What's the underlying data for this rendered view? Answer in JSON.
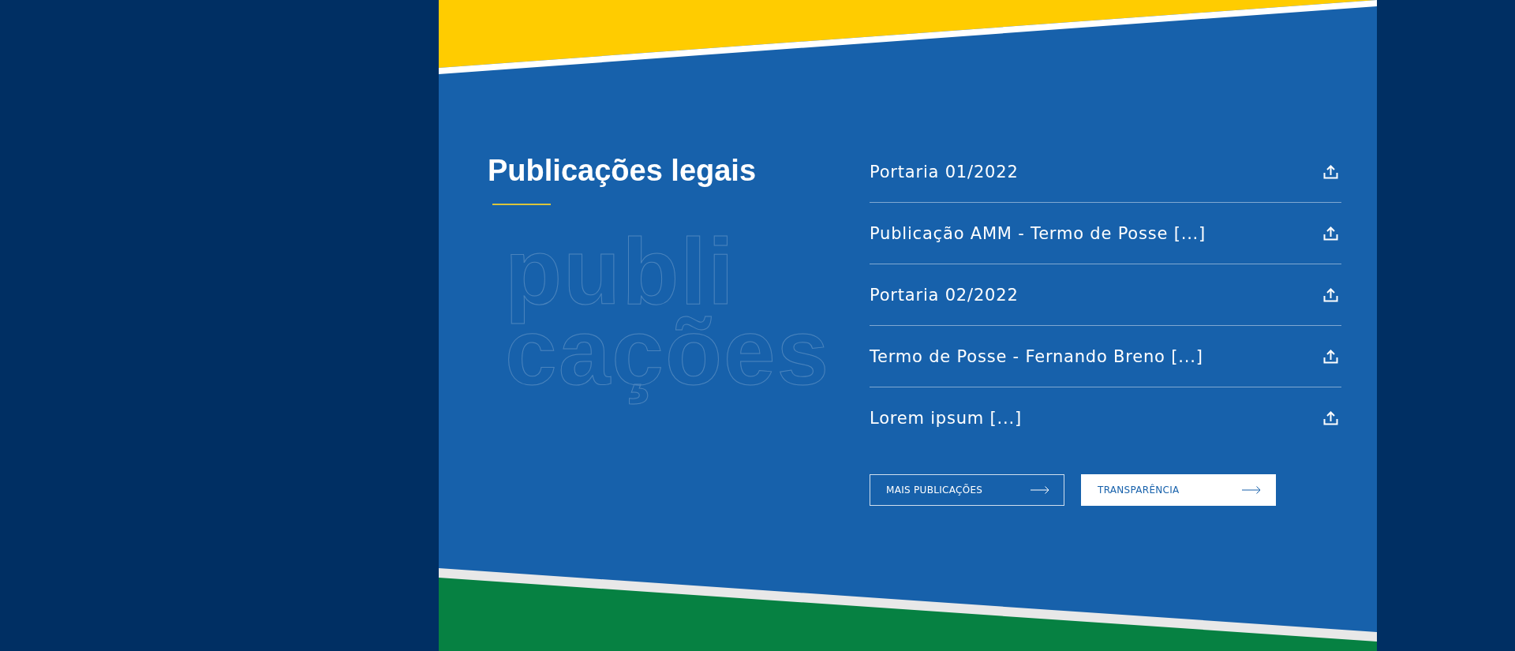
{
  "section": {
    "title": "Publicações legais",
    "backdrop_words": [
      "publi",
      "cações"
    ]
  },
  "publications": [
    {
      "label": "Portaria 01/2022"
    },
    {
      "label": "Publicação AMM - Termo de Posse [...]"
    },
    {
      "label": "Portaria 02/2022"
    },
    {
      "label": "Termo de Posse - Fernando Breno [...]"
    },
    {
      "label": "Lorem ipsum [...]"
    }
  ],
  "buttons": [
    {
      "label": "MAIS PUBLICAÇÕES",
      "kind": "outline"
    },
    {
      "label": "TRANSPARÊNCIA",
      "kind": "solid"
    }
  ]
}
